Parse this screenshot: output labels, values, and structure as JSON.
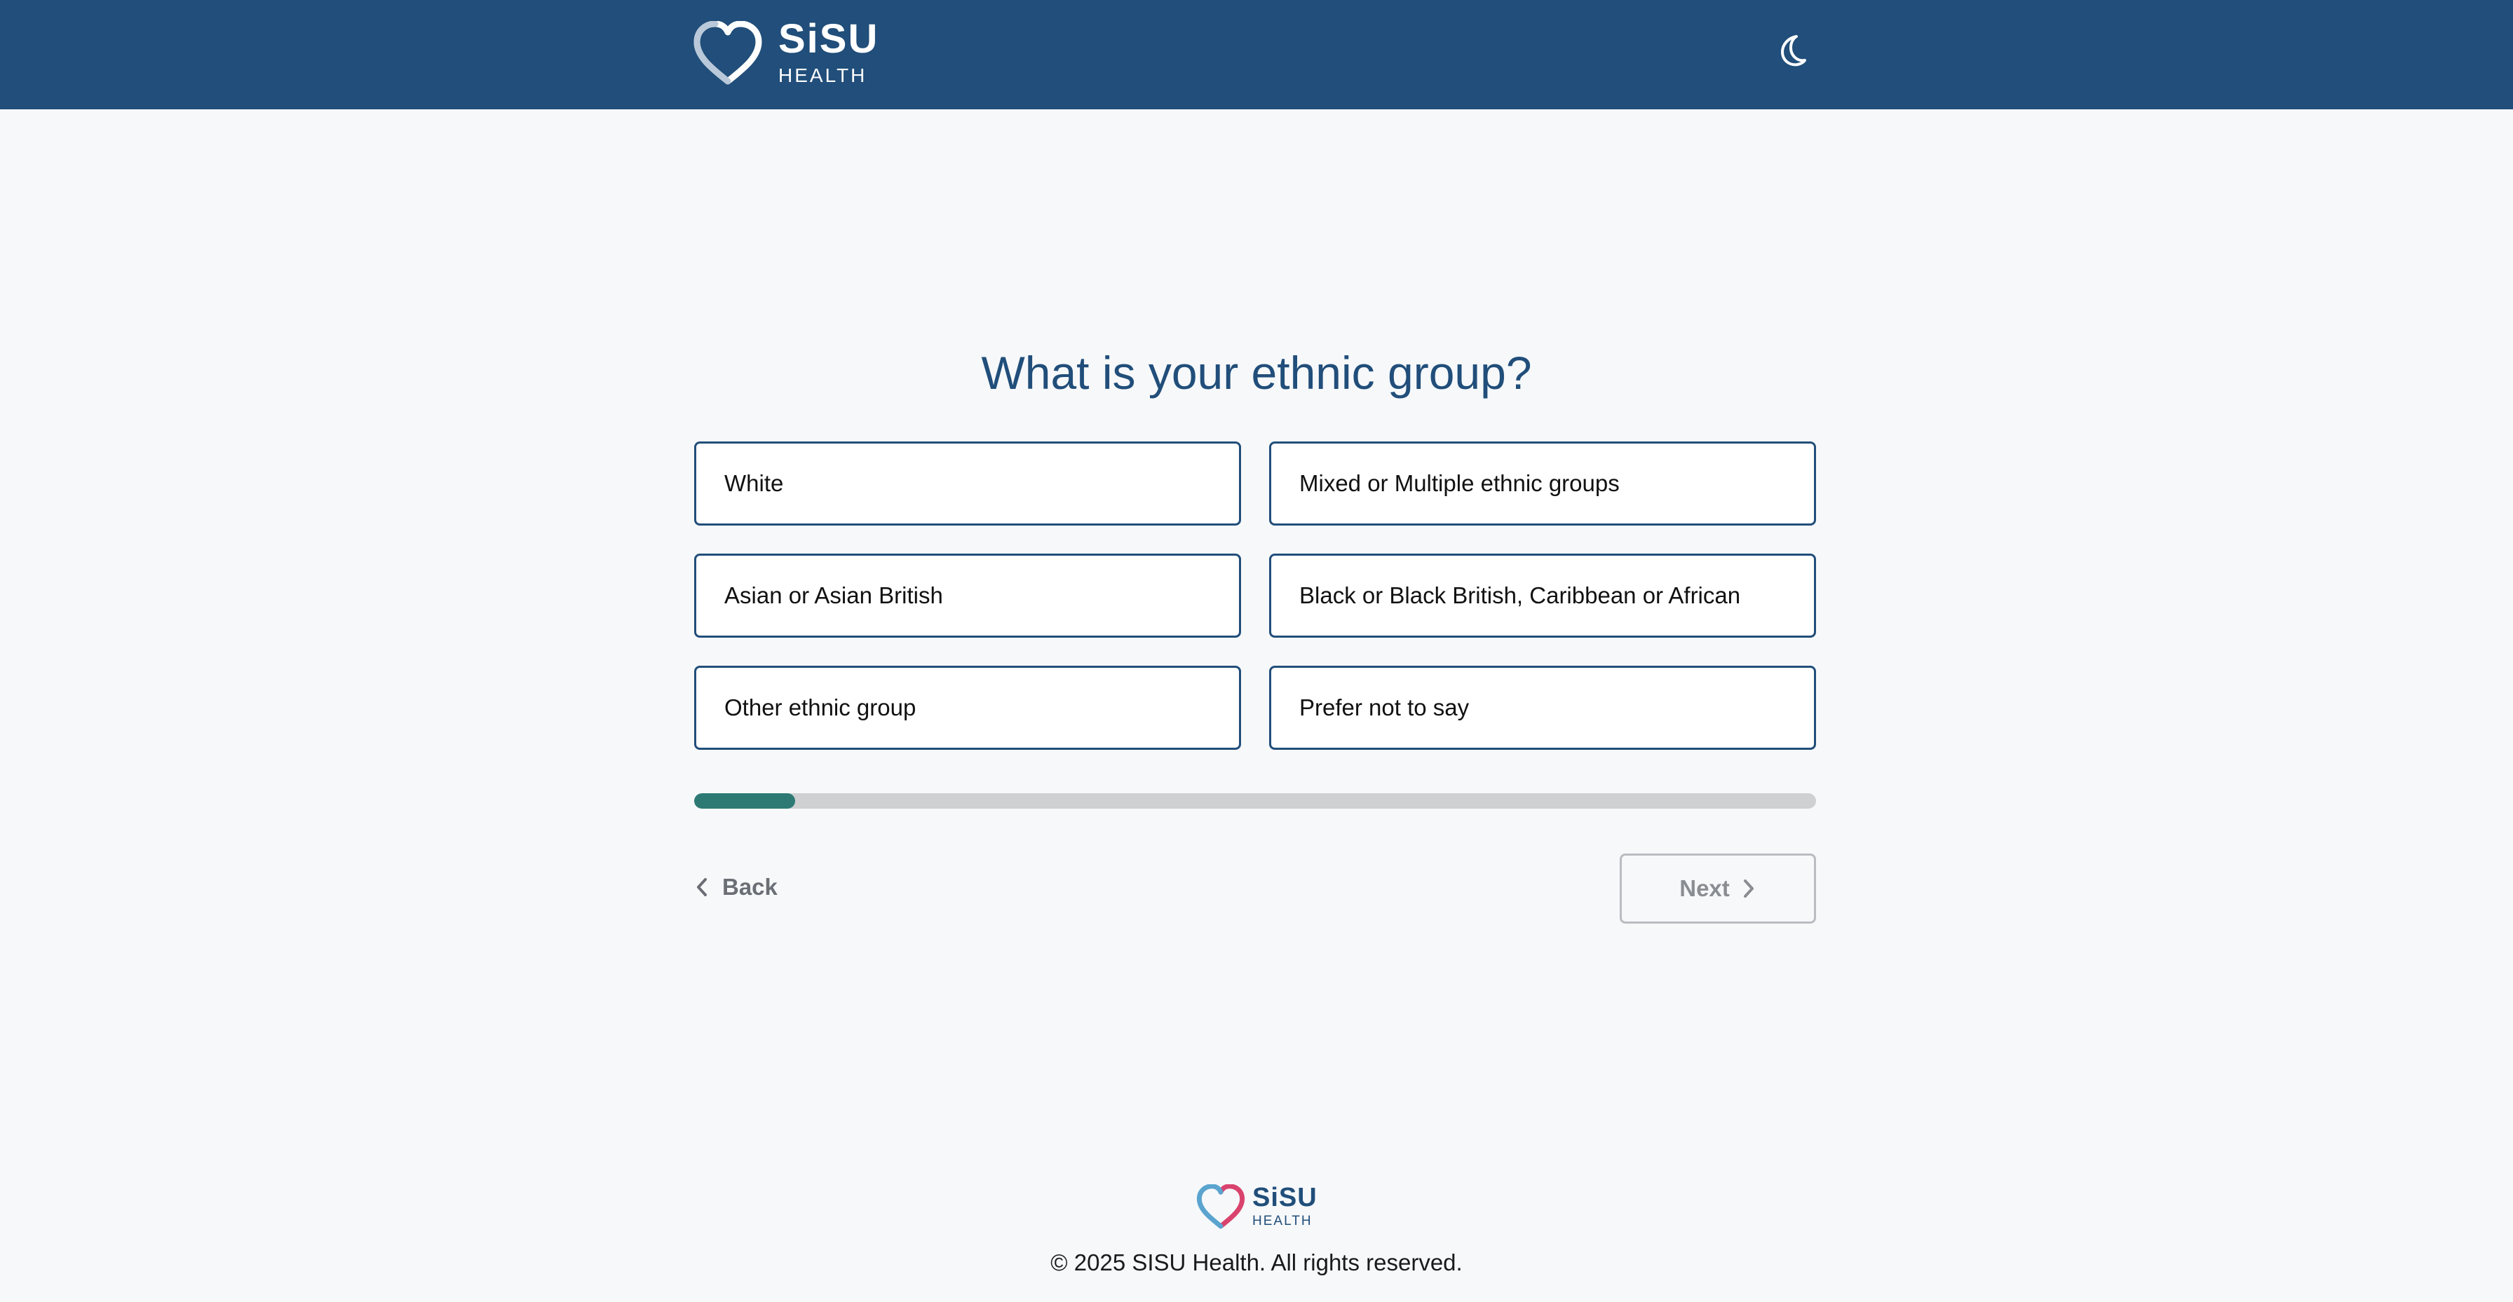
{
  "header": {
    "logo": {
      "brand": "SiSU",
      "sub": "HEALTH",
      "icon": "heart-icon"
    },
    "theme_toggle": {
      "icon": "moon-icon"
    },
    "background_color": "#214e7a"
  },
  "question": {
    "title": "What is your ethnic group?"
  },
  "options": [
    {
      "label": "White"
    },
    {
      "label": "Mixed or Multiple ethnic groups"
    },
    {
      "label": "Asian or Asian British"
    },
    {
      "label": "Black or Black British, Caribbean or African"
    },
    {
      "label": "Other ethnic group"
    },
    {
      "label": "Prefer not to say"
    }
  ],
  "progress": {
    "fraction": 0.09,
    "fill_color": "#2d7a74",
    "track_color": "#cfd0d2"
  },
  "navigation": {
    "back_label": "Back",
    "next_label": "Next",
    "back_icon": "chevron-left-icon",
    "next_icon": "chevron-right-icon"
  },
  "footer": {
    "logo": {
      "brand": "SiSU",
      "sub": "HEALTH"
    },
    "copyright": "© 2025 SISU Health. All rights reserved."
  }
}
